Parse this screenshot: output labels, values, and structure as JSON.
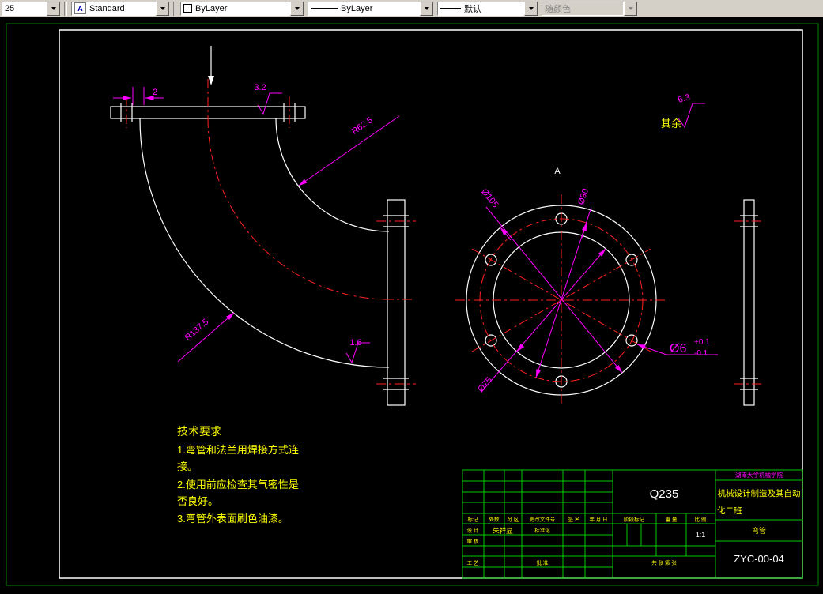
{
  "colors": {
    "background": "#000000",
    "geometry": "#ffffff",
    "dimension": "#ff00ff",
    "centerline": "#ff2020",
    "annotation": "#ffff00",
    "titleblock_grid": "#00c800",
    "toolbar_bg": "#d4d0c8"
  },
  "toolbar": {
    "scale_value": "25",
    "text_style_value": "Standard",
    "color_value": "ByLayer",
    "linetype_value": "ByLayer",
    "lineweight_value": "默认",
    "plot_style_value": "随颜色",
    "icons": {
      "text_style_icon": "A",
      "dropdown_arrow": "▼"
    }
  },
  "drawing": {
    "view_label": "A",
    "dimensions": {
      "flange_thickness": "2",
      "roughness_top": "3.2",
      "roughness_inner": "1.6",
      "roughness_rest_value": "6.3",
      "roughness_rest_label": "其余",
      "inner_radius": "R62.5",
      "outer_radius": "R137.5",
      "outer_diameter": "Ø105",
      "bolt_circle_diameter": "Ø90",
      "bore_diameter": "Ø75",
      "hole_diameter": "Ø6",
      "hole_tol_upper": "+0.1",
      "hole_tol_lower": "-0.1"
    },
    "tech_requirements": {
      "title": "技术要求",
      "line1": "1.弯管和法兰用焊接方式连",
      "line2": "接。",
      "line3": "2.使用前应检查其气密性是",
      "line4": "否良好。",
      "line5": "3.弯管外表面刷色油漆。"
    }
  },
  "title_block": {
    "material": "Q235",
    "school": "湖南大学机械学院",
    "class_line1": "机械设计制造及其自动",
    "class_line2": "化二班",
    "part_name": "弯管",
    "drawing_number": "ZYC-00-04",
    "scale_value": "1:1",
    "designer_name": "朱祥显",
    "headers": {
      "mark": "标记",
      "count": "处数",
      "zone": "分 区",
      "change_file": "更改文件号",
      "signature": "签 名",
      "date": "年 月 日",
      "stage_mark": "阶段标记",
      "weight": "重 量",
      "scale": "比 例",
      "sheet": "共  张  第  张"
    },
    "roles": {
      "design": "设 计",
      "check": "审 核",
      "process": "工 艺",
      "standardization": "标准化",
      "approve": "批 准"
    }
  }
}
